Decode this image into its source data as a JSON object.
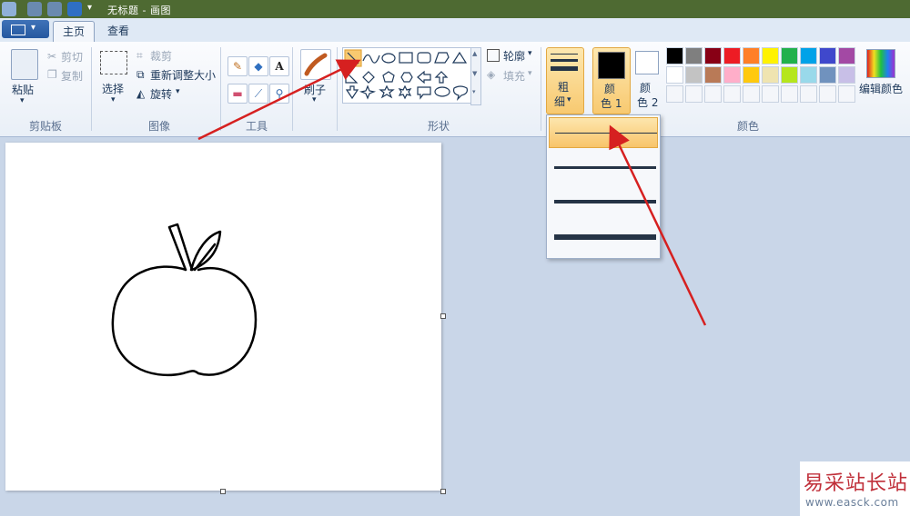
{
  "title": "无标题 - 画图",
  "tabs": {
    "home": "主页",
    "view": "查看"
  },
  "clipboard": {
    "paste": "粘贴",
    "cut": "剪切",
    "copy": "复制",
    "group": "剪贴板"
  },
  "image": {
    "select": "选择",
    "crop": "裁剪",
    "resize": "重新调整大小",
    "rotate": "旋转",
    "group": "图像"
  },
  "tools": {
    "group": "工具"
  },
  "brush": {
    "label": "刷子"
  },
  "shapes": {
    "outline": "轮廓",
    "fill": "填充",
    "group": "形状"
  },
  "size": {
    "line1": "粗",
    "line2": "细"
  },
  "colors": {
    "color1_line1": "颜",
    "color1_line2": "色 1",
    "color2_line1": "颜",
    "color2_line2": "色 2",
    "edit": "编辑颜色",
    "group": "颜色",
    "palette_row1": [
      "#000000",
      "#7f7f7f",
      "#880015",
      "#ed1c24",
      "#ff7f27",
      "#fff200",
      "#22b14c",
      "#00a2e8",
      "#3f48cc",
      "#a349a4"
    ],
    "palette_row2": [
      "#ffffff",
      "#c3c3c3",
      "#b97a57",
      "#ffaec9",
      "#ffc90e",
      "#efe4b0",
      "#b5e61d",
      "#99d9ea",
      "#7092be",
      "#c8bfe7"
    ]
  },
  "watermark": {
    "line1": "易采站长站",
    "line2": "www.easck.com"
  },
  "accent": "#f8c970",
  "arrow_color": "#d62020"
}
